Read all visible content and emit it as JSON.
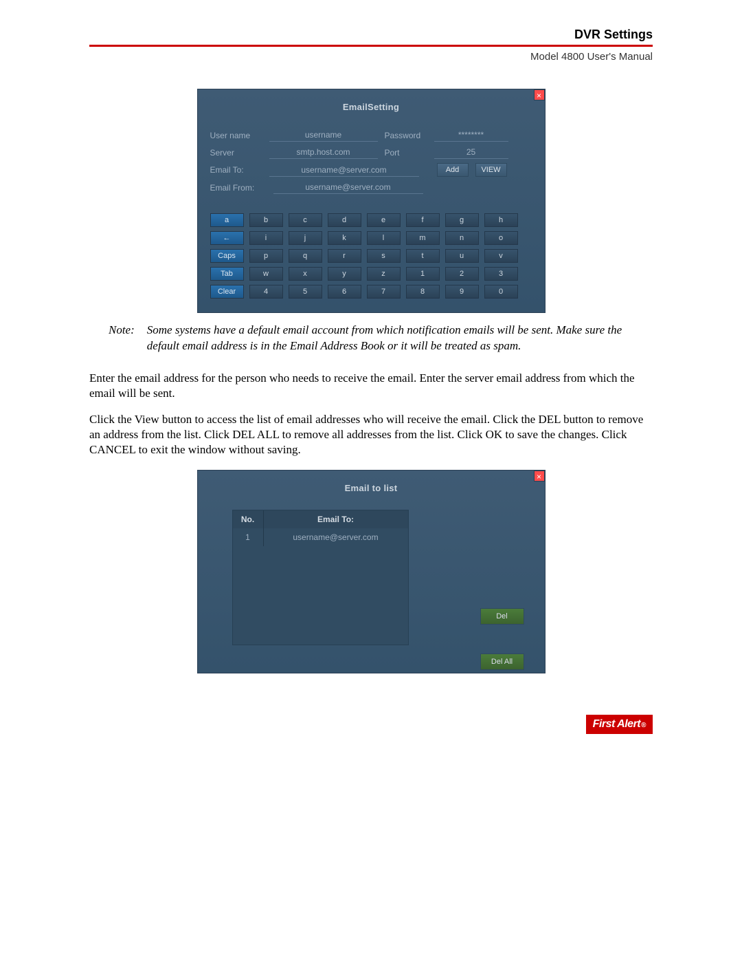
{
  "header": {
    "section_title": "DVR Settings",
    "manual_sub": "Model 4800 User's Manual"
  },
  "email_setting": {
    "window_title": "EmailSetting",
    "close": "×",
    "labels": {
      "username": "User name",
      "password": "Password",
      "server": "Server",
      "port": "Port",
      "email_to": "Email To:",
      "email_from": "Email From:"
    },
    "values": {
      "username": "username",
      "password": "********",
      "server": "smtp.host.com",
      "port": "25",
      "email_to": "username@server.com",
      "email_from": "username@server.com"
    },
    "buttons": {
      "add": "Add",
      "view": "VIEW"
    },
    "keyboard": [
      [
        "a",
        "b",
        "c",
        "d",
        "e",
        "f",
        "g",
        "h"
      ],
      [
        "←",
        "i",
        "j",
        "k",
        "l",
        "m",
        "n",
        "o"
      ],
      [
        "Caps",
        "p",
        "q",
        "r",
        "s",
        "t",
        "u",
        "v"
      ],
      [
        "Tab",
        "w",
        "x",
        "y",
        "z",
        "1",
        "2",
        "3"
      ],
      [
        "Clear",
        "4",
        "5",
        "6",
        "7",
        "8",
        "9",
        "0"
      ]
    ]
  },
  "note": {
    "label": "Note:",
    "body": "Some systems have a default email account from which notification emails will be sent. Make sure the default email address is in the Email Address Book or it will be treated as spam."
  },
  "para1": "Enter the email address for the person who needs to receive the email. Enter the server email address from which the email will be sent.",
  "para2": "Click the View button to access the list of email addresses who will receive the email. Click the DEL button to remove an address from the list. Click DEL ALL to remove all addresses from the list. Click OK to save the changes. Click CANCEL to exit the window without saving.",
  "email_list": {
    "window_title": "Email to list",
    "close": "×",
    "columns": {
      "no": "No.",
      "to": "Email To:"
    },
    "rows": [
      {
        "no": "1",
        "to": "username@server.com"
      }
    ],
    "buttons": {
      "del": "Del",
      "del_all": "Del All"
    }
  },
  "footer": {
    "brand": "First Alert",
    "reg": "®"
  }
}
